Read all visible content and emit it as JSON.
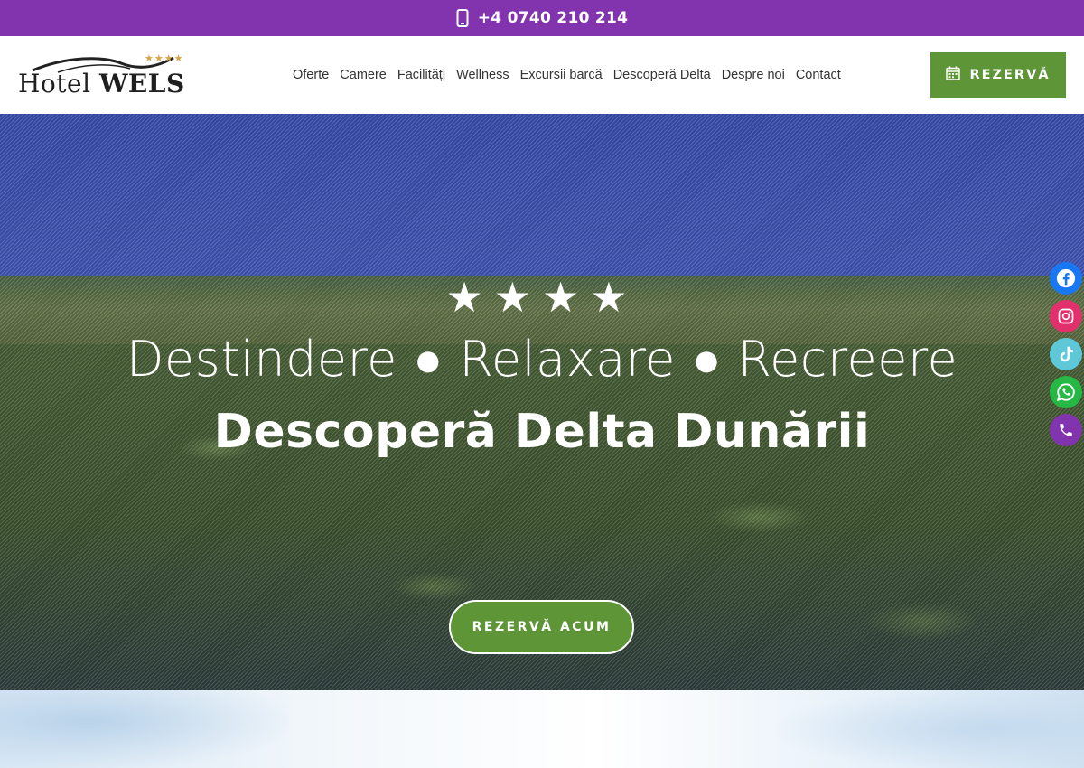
{
  "topbar": {
    "phone": "+4 0740 210 214",
    "icon": "mobile-phone-icon",
    "bg_color": "#8134ad"
  },
  "logo": {
    "name_part1": "Hotel",
    "name_part2": "WELS",
    "stars": "★★★★"
  },
  "nav": {
    "items": [
      "Oferte",
      "Camere",
      "Facilități",
      "Wellness",
      "Excursii barcă",
      "Descoperă Delta",
      "Despre noi",
      "Contact"
    ]
  },
  "header": {
    "book_label": "REZERVĂ",
    "book_icon": "calendar-icon",
    "accent": "#5e9637"
  },
  "hero": {
    "stars": "★★★★",
    "line1": "Destindere ● Relaxare ● Recreere",
    "line2": "Descoperă Delta Dunării",
    "cta_label": "REZERVĂ ACUM"
  },
  "social": [
    {
      "name": "facebook-icon",
      "color": "#1877f2"
    },
    {
      "name": "instagram-icon",
      "color": "#e1306c"
    },
    {
      "name": "tiktok-icon",
      "color": "#5ec8d8"
    },
    {
      "name": "whatsapp-icon",
      "color": "#25b845"
    },
    {
      "name": "phone-icon",
      "color": "#8134ad"
    }
  ]
}
